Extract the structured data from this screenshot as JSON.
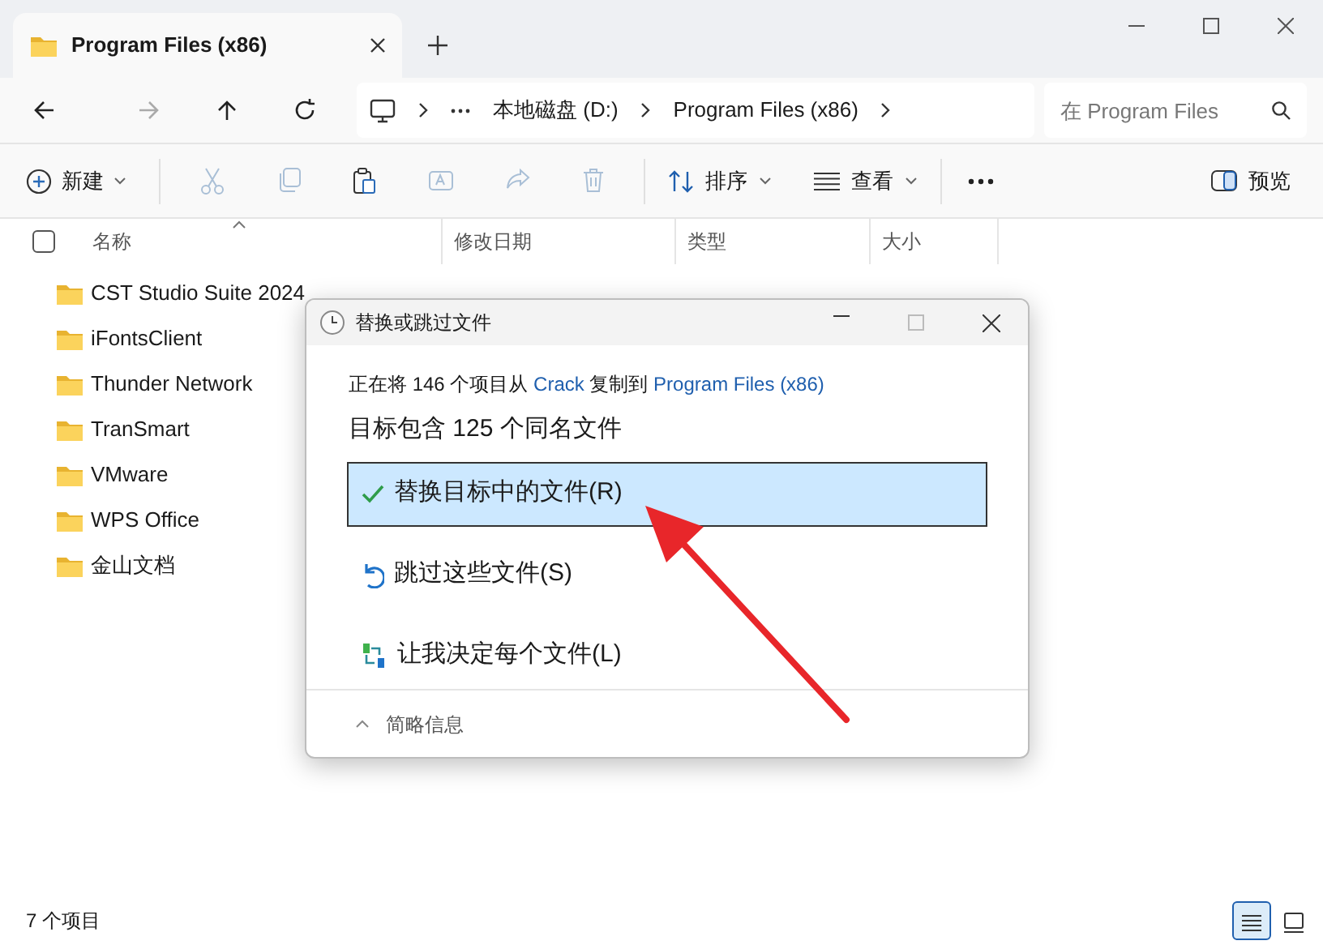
{
  "tab": {
    "title": "Program Files (x86)"
  },
  "address": {
    "breadcrumb": [
      "本地磁盘 (D:)",
      "Program Files (x86)"
    ],
    "search_placeholder": "在 Program Files"
  },
  "toolbar": {
    "new": "新建",
    "actions": [
      {
        "kind": "cut",
        "disabled": true
      },
      {
        "kind": "copy",
        "disabled": true
      },
      {
        "kind": "paste",
        "disabled": false
      },
      {
        "kind": "rename",
        "disabled": true
      },
      {
        "kind": "share",
        "disabled": true
      },
      {
        "kind": "delete",
        "disabled": true
      }
    ],
    "sort": "排序",
    "view": "查看",
    "preview": "预览"
  },
  "select_all": {
    "checked": false
  },
  "columns": [
    "名称",
    "修改日期",
    "类型",
    "大小"
  ],
  "rows": [
    {
      "name": "CST Studio Suite 2024"
    },
    {
      "name": "iFontsClient"
    },
    {
      "name": "Thunder Network"
    },
    {
      "name": "TranSmart"
    },
    {
      "name": "VMware"
    },
    {
      "name": "WPS Office"
    },
    {
      "name": "金山文档"
    }
  ],
  "status_bar": {
    "count": "7 个项目",
    "views": [
      {
        "kind": "details",
        "selected": true
      },
      {
        "kind": "tiles",
        "selected": false
      }
    ]
  },
  "dialog": {
    "title": "替换或跳过文件",
    "message": [
      {
        "kind": "plain",
        "text": "正在将 146 个项目从 "
      },
      {
        "kind": "link",
        "text": "Crack"
      },
      {
        "kind": "plain",
        "text": " 复制到 "
      },
      {
        "kind": "link",
        "text": "Program Files (x86)"
      }
    ],
    "heading": "目标包含 125 个同名文件",
    "options": [
      {
        "kind": "replace",
        "label": "替换目标中的文件(R)",
        "selected": true
      },
      {
        "kind": "skip",
        "label": "跳过这些文件(S)",
        "selected": false
      },
      {
        "kind": "decide",
        "label": "让我决定每个文件(L)",
        "selected": false
      }
    ],
    "details_toggle": "简略信息"
  }
}
